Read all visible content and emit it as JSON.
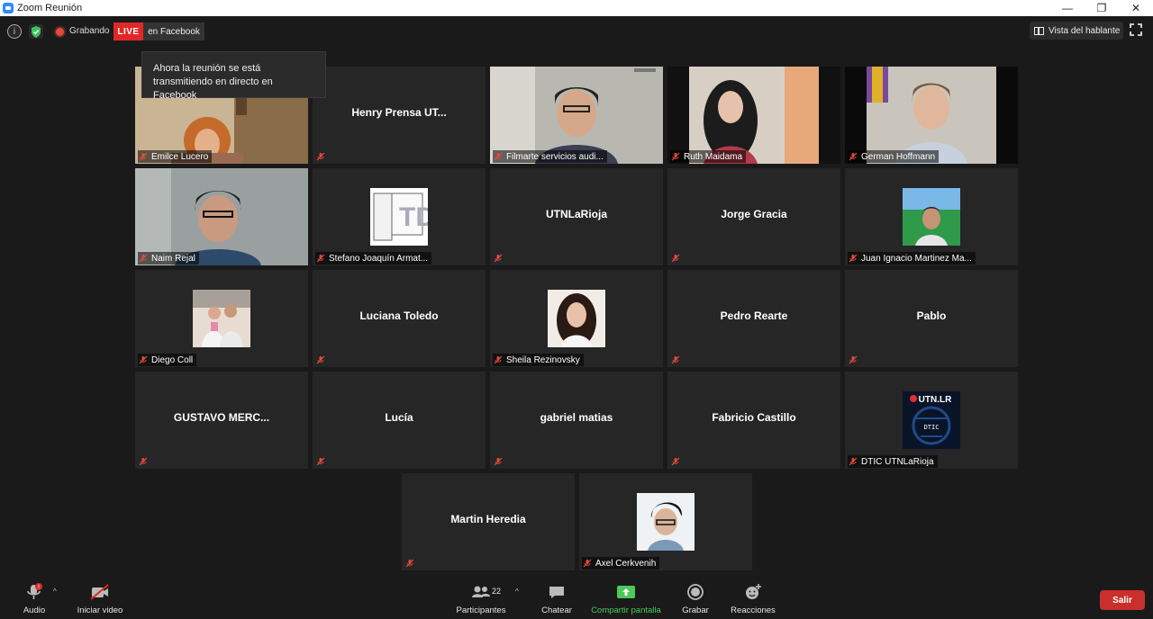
{
  "window": {
    "title": "Zoom Reunión"
  },
  "topbar": {
    "recording_label": "Grabando",
    "live_badge": "LIVE",
    "live_destination": "en Facebook",
    "tooltip": "Ahora la reunión se está transmitiendo en directo en Facebook",
    "view_label": "Vista del hablante"
  },
  "participants": [
    {
      "name": "Emilce Lucero",
      "type": "video"
    },
    {
      "name": "Henry Prensa UT...",
      "type": "name"
    },
    {
      "name": "Filmarte servicios audi...",
      "type": "video"
    },
    {
      "name": "Ruth Maidama",
      "type": "video"
    },
    {
      "name": "German Hoffmann",
      "type": "video"
    },
    {
      "name": "Naim Rejal",
      "type": "video",
      "active": true
    },
    {
      "name": "Stefano Joaquín Armat...",
      "type": "avatar"
    },
    {
      "name": "UTNLaRioja",
      "type": "name"
    },
    {
      "name": "Jorge Gracia",
      "type": "name"
    },
    {
      "name": "Juan Ignacio Martinez Ma...",
      "type": "avatar"
    },
    {
      "name": "Diego Coll",
      "type": "avatar"
    },
    {
      "name": "Luciana Toledo",
      "type": "name"
    },
    {
      "name": "Sheila Rezinovsky",
      "type": "avatar"
    },
    {
      "name": "Pedro Rearte",
      "type": "name"
    },
    {
      "name": "Pablo",
      "type": "name"
    },
    {
      "name": "GUSTAVO  MERC...",
      "type": "name"
    },
    {
      "name": "Lucía",
      "type": "name"
    },
    {
      "name": "gabriel matias",
      "type": "name"
    },
    {
      "name": "Fabricio Castillo",
      "type": "name"
    },
    {
      "name": "DTIC UTNLaRioja",
      "type": "avatar"
    },
    {
      "name": "Martin Heredia",
      "type": "name"
    },
    {
      "name": "Axel Cerkvenih",
      "type": "avatar"
    }
  ],
  "avatar_texts": {
    "utn_logo": "UTN.LR",
    "dtic_logo": "DTIC",
    "td_logo": "TD"
  },
  "toolbar": {
    "audio": "Audio",
    "audio_badge": "!",
    "video": "Iniciar video",
    "participants": "Participantes",
    "participants_count": "22",
    "chat": "Chatear",
    "share": "Compartir pantalla",
    "record": "Grabar",
    "reactions": "Reacciones",
    "leave": "Salir"
  },
  "colors": {
    "live": "#e02828",
    "share_green": "#4cc95a",
    "leave_red": "#c9302c",
    "active_border": "#c8d854"
  }
}
